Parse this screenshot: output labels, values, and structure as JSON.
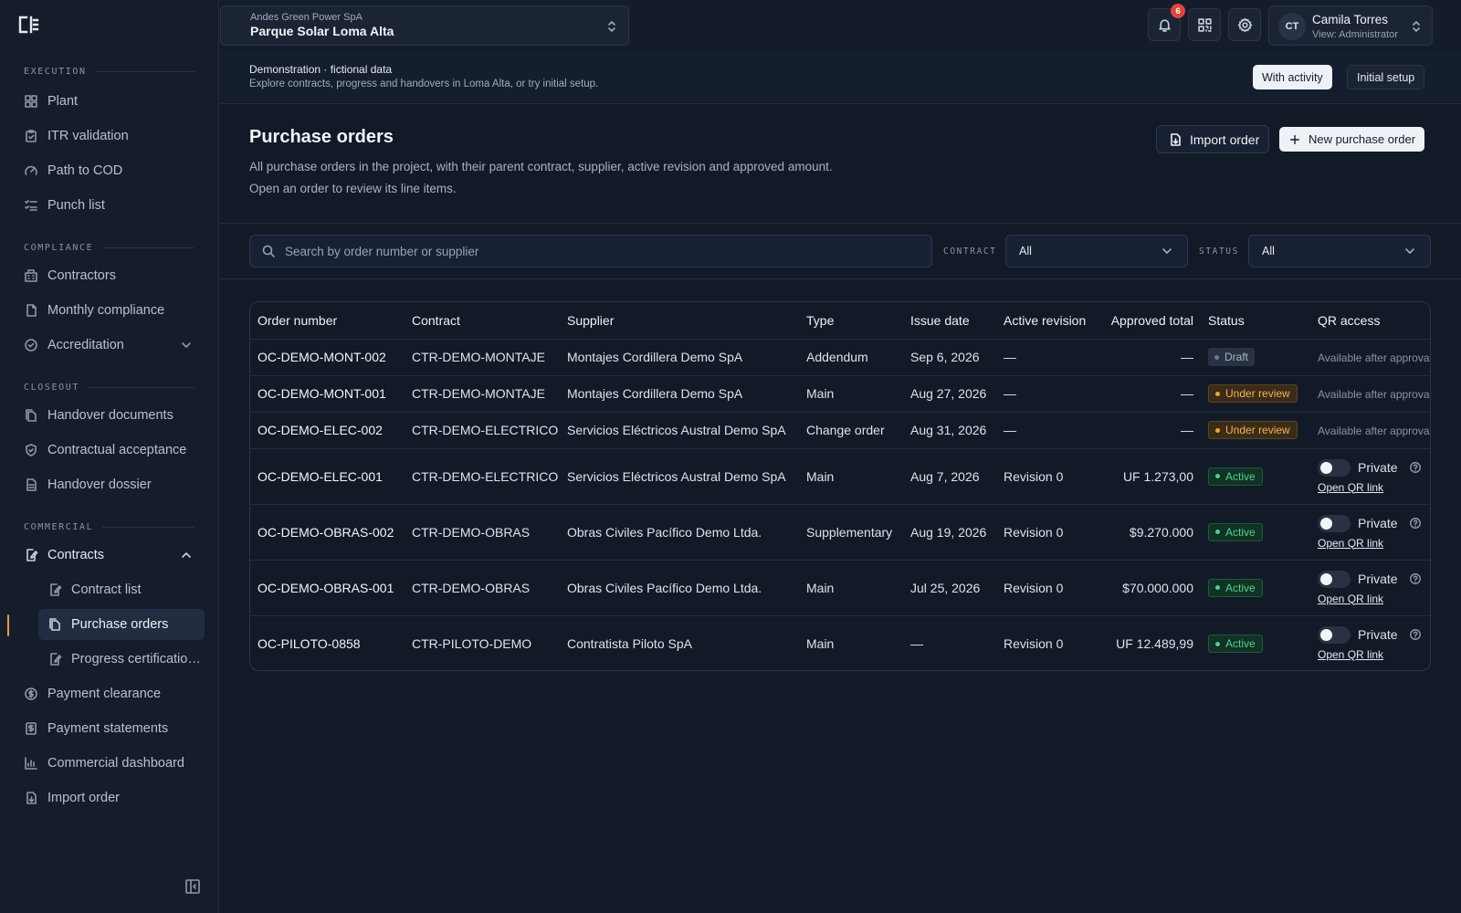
{
  "sidebar": {
    "sections": [
      {
        "title": "EXECUTION",
        "items": [
          {
            "label": "Plant",
            "icon": "grid-icon"
          },
          {
            "label": "ITR validation",
            "icon": "clipboard-check-icon"
          },
          {
            "label": "Path to COD",
            "icon": "gauge-icon"
          },
          {
            "label": "Punch list",
            "icon": "list-check-icon"
          }
        ]
      },
      {
        "title": "COMPLIANCE",
        "items": [
          {
            "label": "Contractors",
            "icon": "building-icon"
          },
          {
            "label": "Monthly compliance",
            "icon": "file-icon"
          },
          {
            "label": "Accreditation",
            "icon": "badge-check-icon"
          }
        ]
      },
      {
        "title": "CLOSEOUT",
        "items": [
          {
            "label": "Handover documents",
            "icon": "files-icon"
          },
          {
            "label": "Contractual acceptance",
            "icon": "handshake-icon"
          },
          {
            "label": "Handover dossier",
            "icon": "file-text-icon"
          }
        ]
      },
      {
        "title": "COMMERCIAL",
        "items": [
          {
            "label": "Contracts",
            "icon": "file-edit-icon"
          },
          {
            "label": "Contract list",
            "icon": "file-edit-icon"
          },
          {
            "label": "Purchase orders",
            "icon": "files-icon",
            "active": true
          },
          {
            "label": "Progress certificatio…",
            "icon": "file-edit-icon"
          },
          {
            "label": "Payment clearance",
            "icon": "dollar-circle-icon"
          },
          {
            "label": "Payment statements",
            "icon": "dollar-doc-icon"
          },
          {
            "label": "Commercial dashboard",
            "icon": "bar-chart-icon"
          },
          {
            "label": "Import order",
            "icon": "file-import-icon"
          }
        ]
      }
    ]
  },
  "project": {
    "company": "Andes Green Power SpA",
    "name": "Parque Solar Loma Alta"
  },
  "notifications": {
    "count": "6"
  },
  "user": {
    "initials": "CT",
    "name": "Camila Torres",
    "role": "View: Administrator"
  },
  "demo": {
    "title": "Demonstration · fictional data",
    "subtitle": "Explore contracts, progress and handovers in Loma Alta, or try initial setup.",
    "with_activity": "With activity",
    "initial_setup": "Initial setup"
  },
  "page": {
    "title": "Purchase orders",
    "description": "All purchase orders in the project, with their parent contract, supplier, active revision and approved amount. Open an order to review its line items.",
    "import_label": "Import order",
    "new_label": "New purchase order"
  },
  "filters": {
    "search_placeholder": "Search by order number or supplier",
    "contract_label": "CONTRACT",
    "contract_value": "All",
    "status_label": "STATUS",
    "status_value": "All"
  },
  "table": {
    "columns": [
      "Order number",
      "Contract",
      "Supplier",
      "Type",
      "Issue date",
      "Active revision",
      "Approved total",
      "Status",
      "QR access"
    ],
    "rows": [
      {
        "order": "OC-DEMO-MONT-002",
        "contract": "CTR-DEMO-MONTAJE",
        "supplier": "Montajes Cordillera Demo SpA",
        "type": "Addendum",
        "date": "Sep 6, 2026",
        "revision": "—",
        "total": "—",
        "status": "Draft",
        "status_kind": "draft",
        "qr": "Available after approval"
      },
      {
        "order": "OC-DEMO-MONT-001",
        "contract": "CTR-DEMO-MONTAJE",
        "supplier": "Montajes Cordillera Demo SpA",
        "type": "Main",
        "date": "Aug 27, 2026",
        "revision": "—",
        "total": "—",
        "status": "Under review",
        "status_kind": "review",
        "qr": "Available after approval"
      },
      {
        "order": "OC-DEMO-ELEC-002",
        "contract": "CTR-DEMO-ELECTRICO",
        "supplier": "Servicios Eléctricos Austral Demo SpA",
        "type": "Change order",
        "date": "Aug 31, 2026",
        "revision": "—",
        "total": "—",
        "status": "Under review",
        "status_kind": "review",
        "qr": "Available after approval"
      },
      {
        "order": "OC-DEMO-ELEC-001",
        "contract": "CTR-DEMO-ELECTRICO",
        "supplier": "Servicios Eléctricos Austral Demo SpA",
        "type": "Main",
        "date": "Aug 7, 2026",
        "revision": "Revision 0",
        "total": "UF 1.273,00",
        "status": "Active",
        "status_kind": "active",
        "qr_private": "Private",
        "qr_link": "Open QR link"
      },
      {
        "order": "OC-DEMO-OBRAS-002",
        "contract": "CTR-DEMO-OBRAS",
        "supplier": "Obras Civiles Pacífico Demo Ltda.",
        "type": "Supplementary",
        "date": "Aug 19, 2026",
        "revision": "Revision 0",
        "total": "$9.270.000",
        "status": "Active",
        "status_kind": "active",
        "qr_private": "Private",
        "qr_link": "Open QR link"
      },
      {
        "order": "OC-DEMO-OBRAS-001",
        "contract": "CTR-DEMO-OBRAS",
        "supplier": "Obras Civiles Pacífico Demo Ltda.",
        "type": "Main",
        "date": "Jul 25, 2026",
        "revision": "Revision 0",
        "total": "$70.000.000",
        "status": "Active",
        "status_kind": "active",
        "qr_private": "Private",
        "qr_link": "Open QR link"
      },
      {
        "order": "OC-PILOTO-0858",
        "contract": "CTR-PILOTO-DEMO",
        "supplier": "Contratista Piloto SpA",
        "type": "Main",
        "date": "—",
        "revision": "Revision 0",
        "total": "UF 12.489,99",
        "status": "Active",
        "status_kind": "active",
        "qr_private": "Private",
        "qr_link": "Open QR link"
      }
    ]
  }
}
